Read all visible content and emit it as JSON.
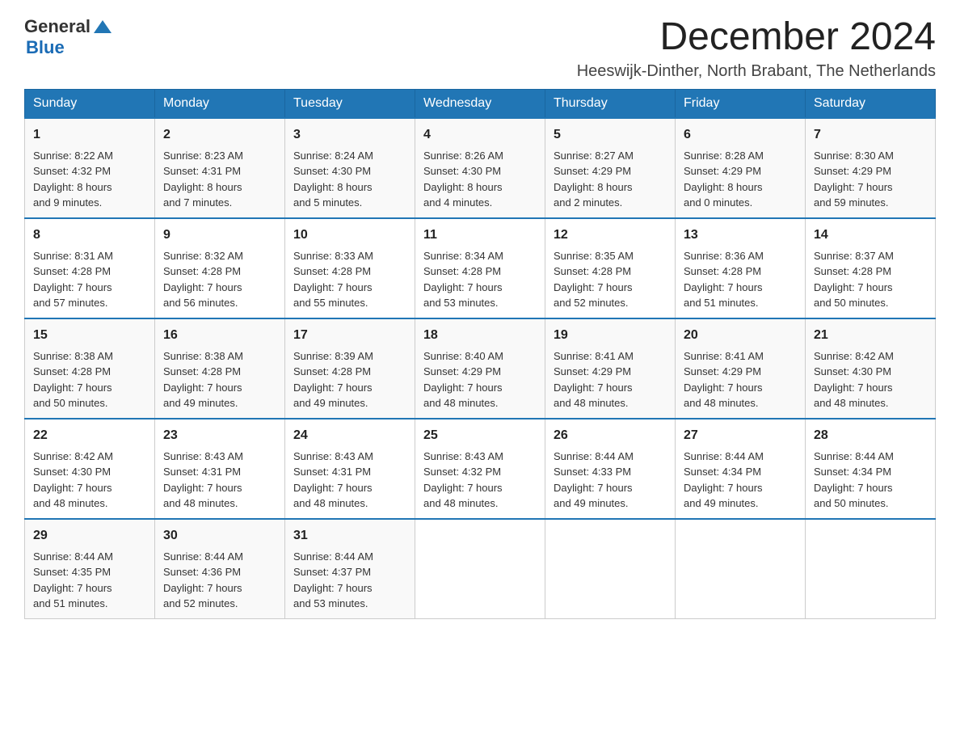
{
  "header": {
    "logo_general": "General",
    "logo_blue": "Blue",
    "month_title": "December 2024",
    "subtitle": "Heeswijk-Dinther, North Brabant, The Netherlands"
  },
  "days_of_week": [
    "Sunday",
    "Monday",
    "Tuesday",
    "Wednesday",
    "Thursday",
    "Friday",
    "Saturday"
  ],
  "weeks": [
    [
      {
        "day": "1",
        "sunrise": "8:22 AM",
        "sunset": "4:32 PM",
        "daylight": "8 hours and 9 minutes."
      },
      {
        "day": "2",
        "sunrise": "8:23 AM",
        "sunset": "4:31 PM",
        "daylight": "8 hours and 7 minutes."
      },
      {
        "day": "3",
        "sunrise": "8:24 AM",
        "sunset": "4:30 PM",
        "daylight": "8 hours and 5 minutes."
      },
      {
        "day": "4",
        "sunrise": "8:26 AM",
        "sunset": "4:30 PM",
        "daylight": "8 hours and 4 minutes."
      },
      {
        "day": "5",
        "sunrise": "8:27 AM",
        "sunset": "4:29 PM",
        "daylight": "8 hours and 2 minutes."
      },
      {
        "day": "6",
        "sunrise": "8:28 AM",
        "sunset": "4:29 PM",
        "daylight": "8 hours and 0 minutes."
      },
      {
        "day": "7",
        "sunrise": "8:30 AM",
        "sunset": "4:29 PM",
        "daylight": "7 hours and 59 minutes."
      }
    ],
    [
      {
        "day": "8",
        "sunrise": "8:31 AM",
        "sunset": "4:28 PM",
        "daylight": "7 hours and 57 minutes."
      },
      {
        "day": "9",
        "sunrise": "8:32 AM",
        "sunset": "4:28 PM",
        "daylight": "7 hours and 56 minutes."
      },
      {
        "day": "10",
        "sunrise": "8:33 AM",
        "sunset": "4:28 PM",
        "daylight": "7 hours and 55 minutes."
      },
      {
        "day": "11",
        "sunrise": "8:34 AM",
        "sunset": "4:28 PM",
        "daylight": "7 hours and 53 minutes."
      },
      {
        "day": "12",
        "sunrise": "8:35 AM",
        "sunset": "4:28 PM",
        "daylight": "7 hours and 52 minutes."
      },
      {
        "day": "13",
        "sunrise": "8:36 AM",
        "sunset": "4:28 PM",
        "daylight": "7 hours and 51 minutes."
      },
      {
        "day": "14",
        "sunrise": "8:37 AM",
        "sunset": "4:28 PM",
        "daylight": "7 hours and 50 minutes."
      }
    ],
    [
      {
        "day": "15",
        "sunrise": "8:38 AM",
        "sunset": "4:28 PM",
        "daylight": "7 hours and 50 minutes."
      },
      {
        "day": "16",
        "sunrise": "8:38 AM",
        "sunset": "4:28 PM",
        "daylight": "7 hours and 49 minutes."
      },
      {
        "day": "17",
        "sunrise": "8:39 AM",
        "sunset": "4:28 PM",
        "daylight": "7 hours and 49 minutes."
      },
      {
        "day": "18",
        "sunrise": "8:40 AM",
        "sunset": "4:29 PM",
        "daylight": "7 hours and 48 minutes."
      },
      {
        "day": "19",
        "sunrise": "8:41 AM",
        "sunset": "4:29 PM",
        "daylight": "7 hours and 48 minutes."
      },
      {
        "day": "20",
        "sunrise": "8:41 AM",
        "sunset": "4:29 PM",
        "daylight": "7 hours and 48 minutes."
      },
      {
        "day": "21",
        "sunrise": "8:42 AM",
        "sunset": "4:30 PM",
        "daylight": "7 hours and 48 minutes."
      }
    ],
    [
      {
        "day": "22",
        "sunrise": "8:42 AM",
        "sunset": "4:30 PM",
        "daylight": "7 hours and 48 minutes."
      },
      {
        "day": "23",
        "sunrise": "8:43 AM",
        "sunset": "4:31 PM",
        "daylight": "7 hours and 48 minutes."
      },
      {
        "day": "24",
        "sunrise": "8:43 AM",
        "sunset": "4:31 PM",
        "daylight": "7 hours and 48 minutes."
      },
      {
        "day": "25",
        "sunrise": "8:43 AM",
        "sunset": "4:32 PM",
        "daylight": "7 hours and 48 minutes."
      },
      {
        "day": "26",
        "sunrise": "8:44 AM",
        "sunset": "4:33 PM",
        "daylight": "7 hours and 49 minutes."
      },
      {
        "day": "27",
        "sunrise": "8:44 AM",
        "sunset": "4:34 PM",
        "daylight": "7 hours and 49 minutes."
      },
      {
        "day": "28",
        "sunrise": "8:44 AM",
        "sunset": "4:34 PM",
        "daylight": "7 hours and 50 minutes."
      }
    ],
    [
      {
        "day": "29",
        "sunrise": "8:44 AM",
        "sunset": "4:35 PM",
        "daylight": "7 hours and 51 minutes."
      },
      {
        "day": "30",
        "sunrise": "8:44 AM",
        "sunset": "4:36 PM",
        "daylight": "7 hours and 52 minutes."
      },
      {
        "day": "31",
        "sunrise": "8:44 AM",
        "sunset": "4:37 PM",
        "daylight": "7 hours and 53 minutes."
      },
      null,
      null,
      null,
      null
    ]
  ]
}
